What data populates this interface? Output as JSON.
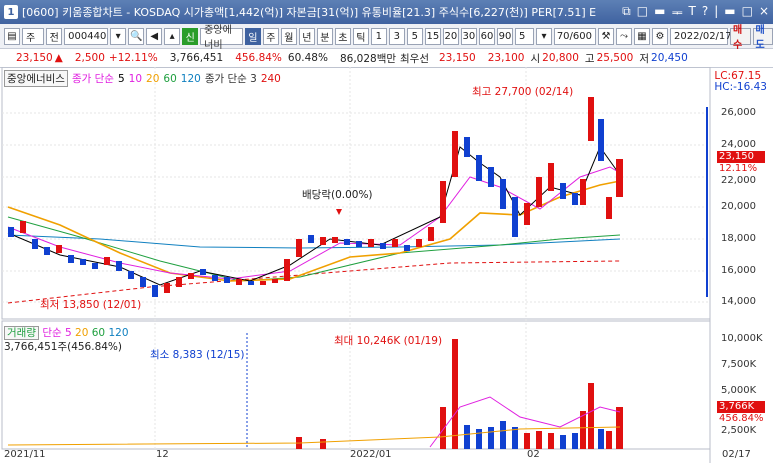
{
  "window": {
    "number": "1",
    "title": "[0600] 키움종합차트 - KOSDAQ 시가총액[1,442(억)] 자본금[31(억)] 유통비율[21.3] 주식수[6,227(천)] PER[7.51] E",
    "buttons": [
      "⧉",
      "□",
      "▬",
      "ᆍ",
      "T",
      "?",
      "|",
      "▬",
      "□",
      "×"
    ]
  },
  "toolbar": {
    "mode": "주",
    "scope": "전",
    "code": "000440",
    "credit_badge": "신",
    "stock_name": "중앙에너비",
    "periods": [
      "일",
      "주",
      "월",
      "년",
      "분",
      "초",
      "틱"
    ],
    "selected_period": "일",
    "intervals": [
      "1",
      "3",
      "5",
      "15",
      "20",
      "30",
      "60",
      "90"
    ],
    "custom_interval": "5",
    "count": "70",
    "count_total": "/600",
    "date": "2022/02/17",
    "buy_label": "매수",
    "sell_label": "매도"
  },
  "quote": {
    "price": "23,150",
    "arrow": "▲",
    "change": "2,500",
    "change_pct": "+12.11%",
    "volume": "3,766,451",
    "volume_ratio": "456.84%",
    "turnover": "60.48%",
    "amount": "86,028백만",
    "best_ask_label": "최우선",
    "best_ask": "23,150",
    "best_bid": "23,100",
    "open_label": "시",
    "open": "20,800",
    "high_label": "고",
    "high": "25,500",
    "low_label": "저",
    "low": "20,450"
  },
  "chart": {
    "legend_name": "중앙에너비스",
    "legend_ma1": "종가 단순",
    "legend_ma1_periods": [
      "5",
      "10",
      "20",
      "60",
      "120"
    ],
    "legend_ma2": "종가 단순 3",
    "legend_ma2_period": "240",
    "lc": "LC:67.15",
    "hc": "HC:-16.43",
    "price_tag": "23,150",
    "pct_tag": "12.11%",
    "high_note": "최고 27,700 (02/14)",
    "low_note": "최저 13,850 (12/01)",
    "dividend_note": "배당락(0.00%)",
    "vol_legend": "거래량",
    "vol_ma": "단순",
    "vol_ma_periods": [
      "5",
      "20",
      "60",
      "120"
    ],
    "vol_sub": "3,766,451주(456.84%)",
    "vol_max_note": "최대 10,246K (01/19)",
    "vol_min_note": "최소 8,383 (12/15)",
    "vol_tag": "3,766K",
    "vol_pct_tag": "456.84%",
    "y_ticks": [
      "26,000",
      "24,000",
      "22,000",
      "20,000",
      "18,000",
      "16,000",
      "14,000"
    ],
    "vol_ticks": [
      "10,000K",
      "7,500K",
      "5,000K",
      "2,500K"
    ],
    "x_labels": [
      "2021/11",
      "12",
      "2022/01",
      "02",
      "02/17"
    ]
  },
  "colors": {
    "up": "#e01010",
    "down": "#1040d0",
    "ma5": "#000000",
    "ma10": "#e020e0",
    "ma20": "#f0a000",
    "ma60": "#20a040",
    "ma120": "#1080c0",
    "ma240": "#e01010"
  }
}
